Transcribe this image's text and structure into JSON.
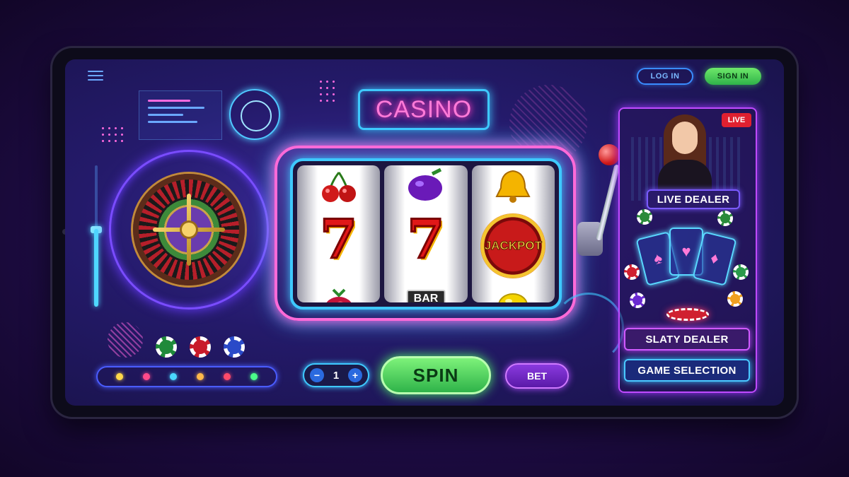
{
  "header": {
    "login_label": "LOG IN",
    "signin_label": "SIGN IN"
  },
  "sign": {
    "title": "CASINO"
  },
  "slot": {
    "reels": [
      [
        "cherry",
        "seven",
        "raspberry"
      ],
      [
        "plum",
        "seven",
        "bar"
      ],
      [
        "bell",
        "jackpot",
        "lemon"
      ]
    ],
    "bar_label": "BAR",
    "jackpot_label": "JACKPOT"
  },
  "controls": {
    "bet_amount": "1",
    "minus_label": "−",
    "plus_label": "+",
    "spin_label": "SPIN",
    "bet_label": "BET"
  },
  "right_panel": {
    "live_badge": "LIVE",
    "live_dealer_label": "LIVE DEALER",
    "slaty_dealer_label": "SLATY DEALER",
    "game_selection_label": "GAME SELECTION",
    "card_suits": [
      "♠",
      "♥",
      "♦"
    ]
  },
  "colors": {
    "neon_pink": "#ff6ad8",
    "neon_cyan": "#3ec9ff",
    "spin_green": "#2fb34a",
    "live_red": "#e02030"
  },
  "icons": {
    "menu": "hamburger-icon",
    "cherry": "cherry-icon",
    "plum": "plum-icon",
    "bell": "bell-icon",
    "raspberry": "raspberry-icon",
    "lemon": "lemon-icon"
  }
}
